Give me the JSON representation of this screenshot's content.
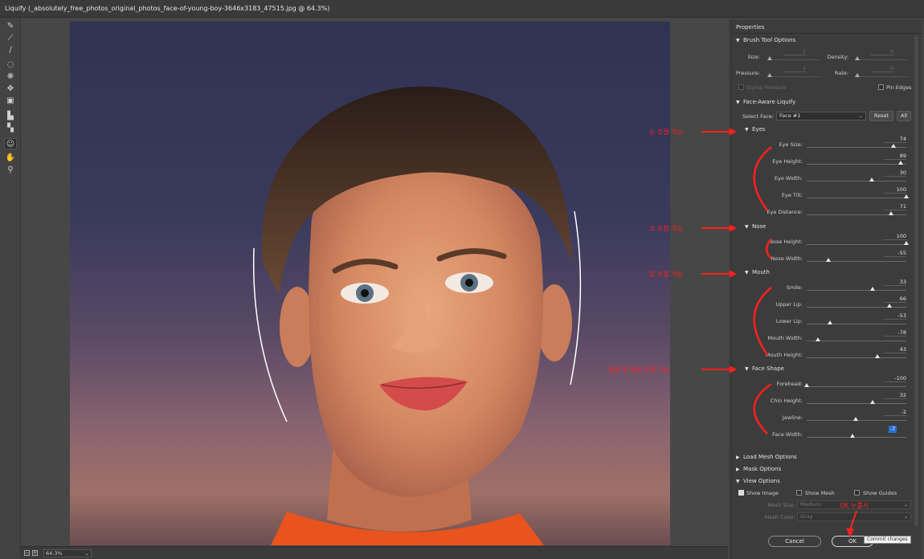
{
  "window": {
    "title": "Liquify (_absolutely_free_photos_original_photos_face-of-young-boy-3646x3183_47515.jpg @ 64.3%)"
  },
  "status": {
    "zoom": "64.3%"
  },
  "properties": {
    "title": "Properties",
    "brush": {
      "header": "Brush Tool Options",
      "size_label": "Size:",
      "size_value": "1",
      "density_label": "Density:",
      "density_value": "0",
      "pressure_label": "Pressure:",
      "pressure_value": "1",
      "rate_label": "Rate:",
      "rate_value": "0",
      "stylus_label": "Stylus Pressure",
      "pin_edges_label": "Pin Edges"
    },
    "face": {
      "header": "Face-Aware Liquify",
      "select_face_label": "Select Face:",
      "select_face_value": "Face #1",
      "reset_label": "Reset",
      "all_label": "All",
      "eyes": {
        "header": "Eyes",
        "rows": [
          {
            "label": "Eye Size:",
            "value": "74",
            "pct": 0.87
          },
          {
            "label": "Eye Height:",
            "value": "89",
            "pct": 0.94
          },
          {
            "label": "Eye Width:",
            "value": "30",
            "pct": 0.65
          },
          {
            "label": "Eye Tilt:",
            "value": "100",
            "pct": 1.0
          },
          {
            "label": "Eye Distance:",
            "value": "71",
            "pct": 0.85
          }
        ]
      },
      "nose": {
        "header": "Nose",
        "rows": [
          {
            "label": "Nose Height:",
            "value": "100",
            "pct": 1.0
          },
          {
            "label": "Nose Width:",
            "value": "-55",
            "pct": 0.22
          }
        ]
      },
      "mouth": {
        "header": "Mouth",
        "rows": [
          {
            "label": "Smile:",
            "value": "33",
            "pct": 0.66
          },
          {
            "label": "Upper Lip:",
            "value": "66",
            "pct": 0.83
          },
          {
            "label": "Lower Lip:",
            "value": "-53",
            "pct": 0.23
          },
          {
            "label": "Mouth Width:",
            "value": "-78",
            "pct": 0.11
          },
          {
            "label": "Mouth Height:",
            "value": "43",
            "pct": 0.71
          }
        ]
      },
      "shape": {
        "header": "Face Shape",
        "rows": [
          {
            "label": "Forehead:",
            "value": "-100",
            "pct": 0.0
          },
          {
            "label": "Chin Height:",
            "value": "32",
            "pct": 0.66
          },
          {
            "label": "Jawline:",
            "value": "-2",
            "pct": 0.49
          },
          {
            "label": "Face Width:",
            "value": "-7",
            "pct": 0.46
          }
        ]
      }
    },
    "load_mesh": "Load Mesh Options",
    "mask": "Mask Options",
    "view": {
      "header": "View Options",
      "show_image": "Show Image",
      "show_mesh": "Show Mesh",
      "show_guides": "Show Guides",
      "mesh_size_label": "Mesh Size:",
      "mesh_size_value": "Medium",
      "mesh_color_label": "Mesh Color:",
      "mesh_color_value": "Gray"
    }
  },
  "buttons": {
    "cancel": "Cancel",
    "ok": "OK",
    "tooltip": "Commit changes"
  },
  "annotations": {
    "eyes": "눈 조절 가능",
    "nose": "코 조절 가능",
    "mouth": "입 조절 가능",
    "shape": "얼굴 및 얼굴 조절 가능",
    "ok": "OK 누를시"
  },
  "colors": {
    "annotation": "#ff2020",
    "selection": "#2a6fd6"
  }
}
